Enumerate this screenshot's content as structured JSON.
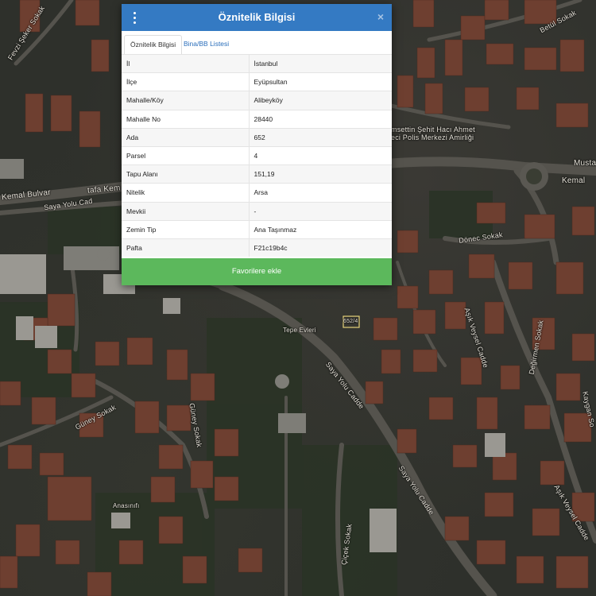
{
  "dialog": {
    "title": "Öznitelik Bilgisi",
    "close_label": "×",
    "tabs": [
      {
        "label": "Öznitelik Bilgisi",
        "active": true
      },
      {
        "label": "Bina/BB Listesi",
        "active": false
      }
    ],
    "rows": [
      {
        "key": "İl",
        "value": "İstanbul"
      },
      {
        "key": "İlçe",
        "value": "Eyüpsultan"
      },
      {
        "key": "Mahalle/Köy",
        "value": "Alibeyköy"
      },
      {
        "key": "Mahalle No",
        "value": "28440"
      },
      {
        "key": "Ada",
        "value": "652"
      },
      {
        "key": "Parsel",
        "value": "4"
      },
      {
        "key": "Tapu Alanı",
        "value": "151,19"
      },
      {
        "key": "Nitelik",
        "value": "Arsa"
      },
      {
        "key": "Mevkii",
        "value": "-"
      },
      {
        "key": "Zemin Tip",
        "value": "Ana Taşınmaz"
      },
      {
        "key": "Pafta",
        "value": "F21c19b4c"
      }
    ],
    "favorite_button": "Favorilere ekle"
  },
  "map": {
    "labels": {
      "fevzi_seker": "Fevzi Şeker Sokak",
      "betul": "Betül Sokak",
      "police1": "msettin Şehit Hacı Ahmet",
      "police2": "eci Polis Merkezi Amirliği",
      "mustafa": "Musta",
      "kemal_bulvar": "Kemal Bulvar",
      "tafa_kemal": "tafa Kem",
      "saya_yolu_cad": "Saya Yolu Cad",
      "kemal_r": "Kemal",
      "donec": "Dönec Sokak",
      "tepe_evleri": "Tepe Evleri",
      "parcel_label": "652/4",
      "saya_yolu_cadde1": "Saya Yolu Cadde",
      "saya_yolu_cadde2": "Saya Yolu Cadde",
      "asik_veysel1": "Aşık Veysel Cadde",
      "asik_veysel2": "Aşık Veysel Cadde",
      "degirmen": "Değirmen Sokak",
      "kaygan": "Kaygan So",
      "guney_sokak": "Güney Sokak",
      "guney_sokak2": "Güney Sokak",
      "anasinifi": "Anasınıfı",
      "cicek_sokak": "Çiçek Sokak"
    }
  }
}
